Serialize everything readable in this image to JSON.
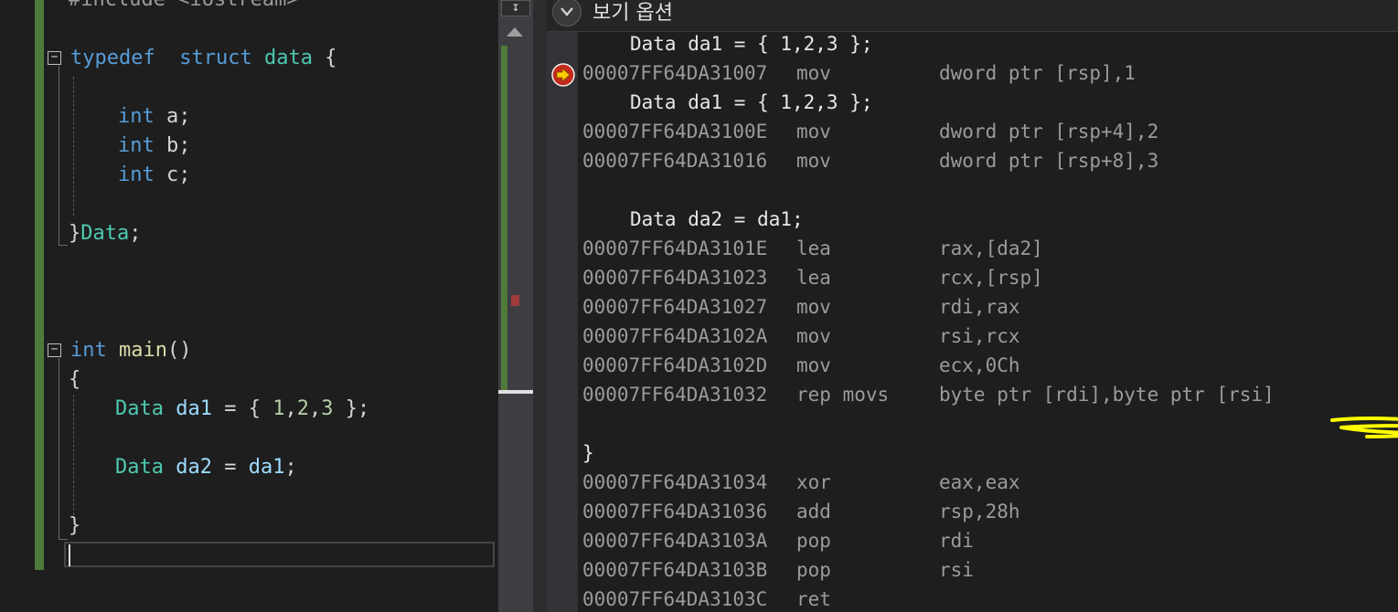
{
  "editor": {
    "lines": [
      {
        "html_parts": [
          [
            "pre",
            "#include <iostream>"
          ]
        ]
      },
      {
        "html_parts": [
          [
            "kw",
            "typedef"
          ],
          [
            "",
            "  "
          ],
          [
            "kw",
            "struct"
          ],
          [
            "",
            " "
          ],
          [
            "ty",
            "data"
          ],
          [
            "",
            " {"
          ]
        ]
      },
      {
        "html_parts": [
          [
            "kw",
            "int"
          ],
          [
            "",
            " a;"
          ]
        ]
      },
      {
        "html_parts": [
          [
            "kw",
            "int"
          ],
          [
            "",
            " b;"
          ]
        ]
      },
      {
        "html_parts": [
          [
            "kw",
            "int"
          ],
          [
            "",
            " c;"
          ]
        ]
      },
      {
        "html_parts": [
          [
            "",
            "}"
          ],
          [
            "ty",
            "Data"
          ],
          [
            "",
            ";"
          ]
        ]
      },
      {
        "html_parts": [
          [
            "kw",
            "int"
          ],
          [
            "",
            " "
          ],
          [
            "fn",
            "main"
          ],
          [
            "",
            "()"
          ]
        ]
      },
      {
        "html_parts": [
          [
            "",
            "{"
          ]
        ]
      },
      {
        "html_parts": [
          [
            "ty",
            "Data"
          ],
          [
            "",
            " "
          ],
          [
            "var",
            "da1"
          ],
          [
            "",
            " = { "
          ],
          [
            "num",
            "1"
          ],
          [
            "",
            ","
          ],
          [
            "num",
            "2"
          ],
          [
            "",
            ","
          ],
          [
            "num",
            "3"
          ],
          [
            "",
            " };"
          ]
        ]
      },
      {
        "html_parts": [
          [
            "ty",
            "Data"
          ],
          [
            "",
            " "
          ],
          [
            "var",
            "da2"
          ],
          [
            "",
            " = "
          ],
          [
            "var",
            "da1"
          ],
          [
            "",
            ";"
          ]
        ]
      },
      {
        "html_parts": [
          [
            "",
            "}"
          ]
        ]
      }
    ]
  },
  "scrollbar": {
    "top_button_glyph": "↧"
  },
  "disassembly": {
    "header": {
      "view_options_label": "보기 옵션"
    },
    "rows": [
      {
        "kind": "src",
        "text": "Data da1 = { 1,2,3 };"
      },
      {
        "kind": "asm",
        "addr": "00007FF64DA31007",
        "op": "mov",
        "arg": "dword ptr [rsp],1",
        "current": true
      },
      {
        "kind": "src",
        "text": "Data da1 = { 1,2,3 };"
      },
      {
        "kind": "asm",
        "addr": "00007FF64DA3100E",
        "op": "mov",
        "arg": "dword ptr [rsp+4],2"
      },
      {
        "kind": "asm",
        "addr": "00007FF64DA31016",
        "op": "mov",
        "arg": "dword ptr [rsp+8],3"
      },
      {
        "kind": "blank"
      },
      {
        "kind": "src",
        "text": "Data da2 = da1;"
      },
      {
        "kind": "asm",
        "addr": "00007FF64DA3101E",
        "op": "lea",
        "arg": "rax,[da2]"
      },
      {
        "kind": "asm",
        "addr": "00007FF64DA31023",
        "op": "lea",
        "arg": "rcx,[rsp]"
      },
      {
        "kind": "asm",
        "addr": "00007FF64DA31027",
        "op": "mov",
        "arg": "rdi,rax"
      },
      {
        "kind": "asm",
        "addr": "00007FF64DA3102A",
        "op": "mov",
        "arg": "rsi,rcx"
      },
      {
        "kind": "asm",
        "addr": "00007FF64DA3102D",
        "op": "mov",
        "arg": "ecx,0Ch"
      },
      {
        "kind": "asm",
        "addr": "00007FF64DA31032",
        "op": "rep movs",
        "arg": "byte ptr [rdi],byte ptr [rsi]"
      },
      {
        "kind": "blank"
      },
      {
        "kind": "brace",
        "text": "}"
      },
      {
        "kind": "asm",
        "addr": "00007FF64DA31034",
        "op": "xor",
        "arg": "eax,eax"
      },
      {
        "kind": "asm",
        "addr": "00007FF64DA31036",
        "op": "add",
        "arg": "rsp,28h"
      },
      {
        "kind": "asm",
        "addr": "00007FF64DA3103A",
        "op": "pop",
        "arg": "rdi"
      },
      {
        "kind": "asm",
        "addr": "00007FF64DA3103B",
        "op": "pop",
        "arg": "rsi"
      },
      {
        "kind": "asm",
        "addr": "00007FF64DA3103C",
        "op": "ret",
        "arg": ""
      }
    ]
  },
  "colors": {
    "background": "#1e1e1e",
    "keyword": "#569cd6",
    "type": "#4ec9b0",
    "function": "#dcdcaa",
    "variable": "#9cdcfe",
    "number": "#b5cea8",
    "change_bar": "#4f7a3a",
    "annotation": "#ffff00",
    "breakpoint": "#c42b1c",
    "current_arrow": "#ffcc00"
  }
}
